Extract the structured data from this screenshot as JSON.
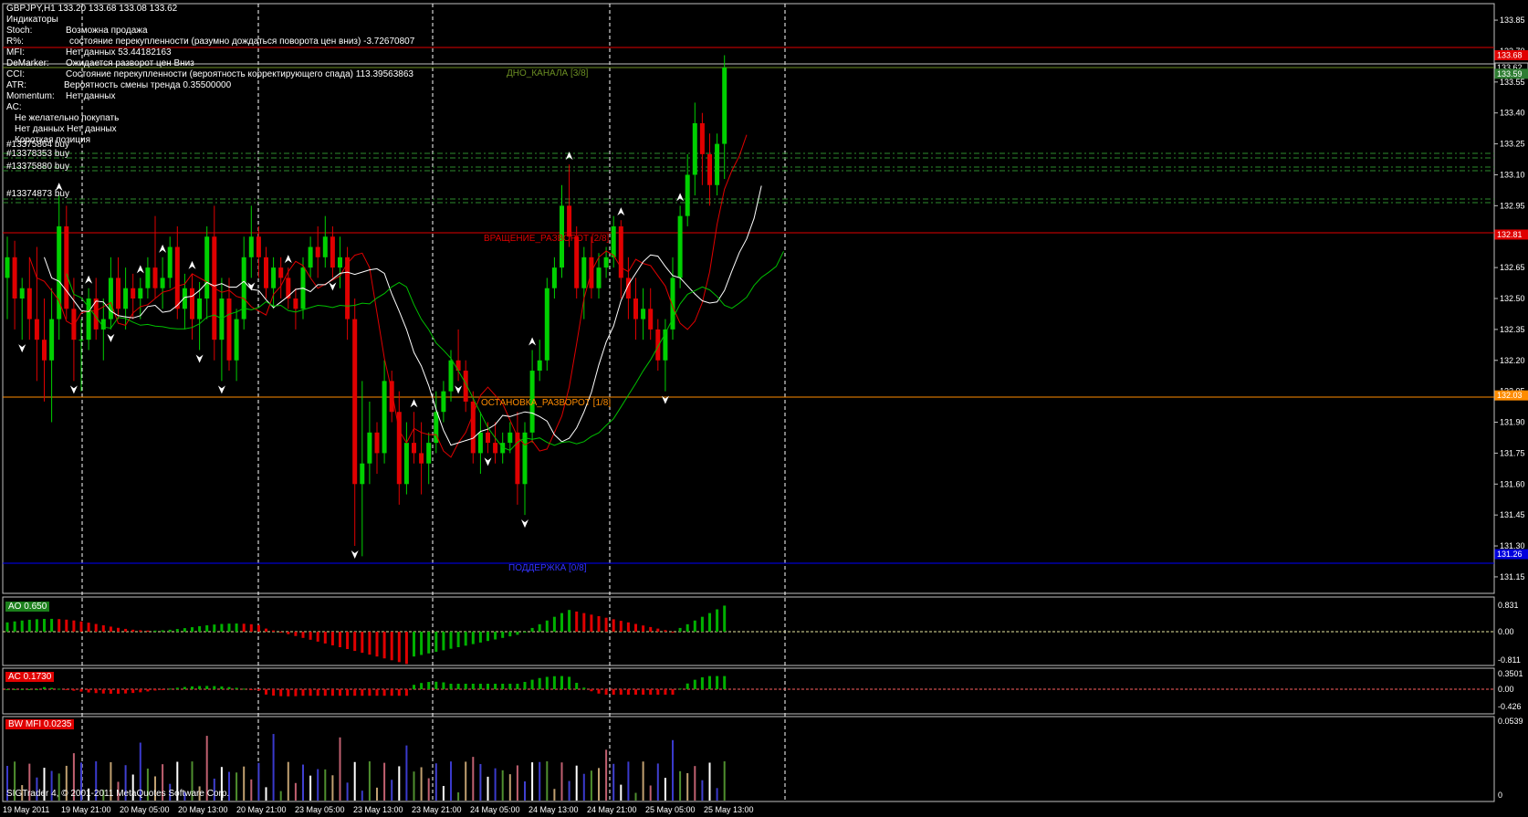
{
  "header": {
    "symbol_line": "GBPJPY,H1  133.20 133.68 133.08 133.62",
    "indicators_title": "Индикаторы",
    "rows": [
      {
        "name": "Stoch:",
        "value": "Возможна продажа"
      },
      {
        "name": "R%:",
        "value": "состояние перекупленности (разумно дождаться поворота цен вниз) -3.72670807"
      },
      {
        "name": "MFI:",
        "value": "Нет данных 53.44182163"
      },
      {
        "name": "DeMarker:",
        "value": "Ожидается разворот цен Вниз"
      },
      {
        "name": "CCI:",
        "value": "Состояние перекупленности (вероятность корректирующего спада) 113.39563863"
      },
      {
        "name": "ATR:",
        "value": "Вероятность смены тренда 0.35500000"
      },
      {
        "name": "Momentum:",
        "value": "Нет данных"
      },
      {
        "name": "AC:",
        "value": ""
      }
    ],
    "notes": [
      "Не желательно покупать",
      "Нет данных Нет данных",
      "Короткая позиция"
    ]
  },
  "orders": [
    "#13375864 buy",
    "#13378353 buy",
    "#13375880 buy",
    "#13374873 buy"
  ],
  "levels": {
    "top_channel": "ДНО_КАНАЛА [3/8]",
    "rotation": "ВРАЩЕНИЕ_РАЗВОРОТ [2/8]",
    "stop": "ОСТАНОВКА_РАЗВОРОТ [1/8]",
    "support": "ПОДДЕРЖКА [0/8]"
  },
  "price_axis": [
    "133.85",
    "133.70",
    "133.55",
    "133.40",
    "133.25",
    "133.10",
    "132.95",
    "132.80",
    "132.65",
    "132.50",
    "132.35",
    "132.20",
    "132.05",
    "131.90",
    "131.75",
    "131.60",
    "131.45",
    "131.30",
    "131.15"
  ],
  "price_tags": [
    {
      "value": "133.68",
      "color": "#e00000"
    },
    {
      "value": "133.62",
      "color": "#000000"
    },
    {
      "value": "133.59",
      "color": "#2e7d32"
    },
    {
      "value": "132.81",
      "color": "#e00000"
    },
    {
      "value": "132.03",
      "color": "#ff8c00"
    },
    {
      "value": "131.26",
      "color": "#0000dd"
    }
  ],
  "time_axis": [
    "19 May 2011",
    "19 May 21:00",
    "20 May 05:00",
    "20 May 13:00",
    "20 May 21:00",
    "23 May 05:00",
    "23 May 13:00",
    "23 May 21:00",
    "24 May 05:00",
    "24 May 13:00",
    "24 May 21:00",
    "25 May 05:00",
    "25 May 13:00"
  ],
  "subwindows": {
    "ao": {
      "label": "AO 0.650",
      "label_color": "#1b7f1b",
      "scale": [
        "0.831",
        "0.00",
        "-0.811"
      ]
    },
    "ac": {
      "label": "AC 0.1730",
      "label_color": "#e00000",
      "scale": [
        "0.3501",
        "0.00",
        "-0.426"
      ]
    },
    "mfi": {
      "label": "BW MFI 0.0235",
      "label_color": "#e00000",
      "scale": [
        "0.0539",
        "0"
      ]
    }
  },
  "copyright": "SIGTrader 4, © 2001-2011 MetaQuotes Software Corp.",
  "colors": {
    "bull": "#00d000",
    "bear": "#e00000",
    "ma_white": "#ffffff",
    "ma_red": "#e00000",
    "ma_green": "#00c000"
  },
  "chart_data": {
    "type": "candlestick",
    "title": "GBPJPY,H1",
    "price_range": [
      131.07,
      133.93
    ],
    "candles": [
      [
        132.6,
        132.8,
        132.4,
        132.7
      ],
      [
        132.7,
        132.78,
        132.35,
        132.5
      ],
      [
        132.5,
        132.6,
        132.3,
        132.55
      ],
      [
        132.55,
        132.7,
        132.3,
        132.4
      ],
      [
        132.4,
        132.75,
        132.1,
        132.3
      ],
      [
        132.3,
        132.5,
        132.0,
        132.2
      ],
      [
        132.2,
        132.55,
        131.9,
        132.4
      ],
      [
        132.4,
        133.0,
        132.3,
        132.85
      ],
      [
        132.85,
        132.95,
        132.4,
        132.45
      ],
      [
        132.45,
        132.6,
        132.1,
        132.3
      ],
      [
        132.3,
        132.4,
        132.05,
        132.3
      ],
      [
        132.3,
        132.55,
        132.25,
        132.5
      ],
      [
        132.5,
        132.6,
        132.3,
        132.35
      ],
      [
        132.35,
        132.5,
        132.2,
        132.4
      ],
      [
        132.4,
        132.7,
        132.35,
        132.6
      ],
      [
        132.6,
        132.7,
        132.4,
        132.45
      ],
      [
        132.45,
        132.65,
        132.35,
        132.55
      ],
      [
        132.55,
        132.62,
        132.4,
        132.5
      ],
      [
        132.5,
        132.6,
        132.4,
        132.55
      ],
      [
        132.55,
        132.7,
        132.5,
        132.65
      ],
      [
        132.65,
        132.9,
        132.5,
        132.55
      ],
      [
        132.55,
        132.7,
        132.45,
        132.6
      ],
      [
        132.6,
        132.8,
        132.55,
        132.75
      ],
      [
        132.75,
        132.85,
        132.4,
        132.45
      ],
      [
        132.45,
        132.62,
        132.35,
        132.55
      ],
      [
        132.55,
        132.62,
        132.3,
        132.4
      ],
      [
        132.4,
        132.58,
        132.25,
        132.5
      ],
      [
        132.5,
        132.85,
        132.4,
        132.8
      ],
      [
        132.8,
        132.95,
        132.2,
        132.3
      ],
      [
        132.3,
        132.6,
        132.1,
        132.5
      ],
      [
        132.5,
        132.6,
        132.15,
        132.2
      ],
      [
        132.2,
        132.45,
        132.1,
        132.4
      ],
      [
        132.4,
        132.8,
        132.35,
        132.7
      ],
      [
        132.7,
        132.95,
        132.6,
        132.8
      ],
      [
        132.8,
        132.85,
        132.6,
        132.7
      ],
      [
        132.7,
        132.75,
        132.5,
        132.55
      ],
      [
        132.55,
        132.7,
        132.45,
        132.65
      ],
      [
        132.65,
        132.7,
        132.5,
        132.6
      ],
      [
        132.6,
        132.65,
        132.45,
        132.5
      ],
      [
        132.5,
        132.55,
        132.35,
        132.45
      ],
      [
        132.45,
        132.7,
        132.4,
        132.65
      ],
      [
        132.65,
        132.8,
        132.6,
        132.75
      ],
      [
        132.75,
        132.85,
        132.6,
        132.7
      ],
      [
        132.7,
        132.9,
        132.65,
        132.8
      ],
      [
        132.8,
        132.85,
        132.6,
        132.65
      ],
      [
        132.65,
        132.8,
        132.55,
        132.7
      ],
      [
        132.7,
        132.75,
        132.3,
        132.4
      ],
      [
        132.4,
        132.5,
        131.3,
        131.6
      ],
      [
        131.6,
        132.1,
        131.25,
        131.7
      ],
      [
        131.7,
        132.0,
        131.6,
        131.85
      ],
      [
        131.85,
        131.9,
        131.65,
        131.75
      ],
      [
        131.75,
        132.2,
        131.7,
        132.1
      ],
      [
        132.1,
        132.15,
        131.9,
        131.95
      ],
      [
        131.95,
        132.05,
        131.5,
        131.6
      ],
      [
        131.6,
        131.9,
        131.55,
        131.8
      ],
      [
        131.8,
        131.95,
        131.7,
        131.75
      ],
      [
        131.75,
        131.9,
        131.55,
        131.7
      ],
      [
        131.7,
        131.85,
        131.6,
        131.8
      ],
      [
        131.8,
        132.05,
        131.75,
        131.95
      ],
      [
        131.95,
        132.1,
        131.9,
        132.05
      ],
      [
        132.05,
        132.25,
        132.0,
        132.2
      ],
      [
        132.2,
        132.35,
        132.1,
        132.15
      ],
      [
        132.15,
        132.2,
        131.95,
        132.0
      ],
      [
        132.0,
        132.05,
        131.7,
        131.75
      ],
      [
        131.75,
        131.95,
        131.65,
        131.85
      ],
      [
        131.85,
        131.9,
        131.75,
        131.8
      ],
      [
        131.8,
        131.9,
        131.7,
        131.75
      ],
      [
        131.75,
        131.85,
        131.7,
        131.8
      ],
      [
        131.8,
        131.9,
        131.75,
        131.85
      ],
      [
        131.85,
        131.95,
        131.5,
        131.6
      ],
      [
        131.6,
        131.9,
        131.45,
        131.85
      ],
      [
        131.85,
        132.25,
        131.8,
        132.15
      ],
      [
        132.15,
        132.3,
        132.1,
        132.2
      ],
      [
        132.2,
        132.6,
        132.15,
        132.55
      ],
      [
        132.55,
        132.7,
        132.5,
        132.65
      ],
      [
        132.65,
        133.05,
        132.6,
        132.95
      ],
      [
        132.95,
        133.15,
        132.75,
        132.8
      ],
      [
        132.8,
        132.85,
        132.5,
        132.55
      ],
      [
        132.55,
        132.75,
        132.4,
        132.7
      ],
      [
        132.7,
        132.8,
        132.5,
        132.55
      ],
      [
        132.55,
        132.72,
        132.5,
        132.65
      ],
      [
        132.65,
        132.75,
        132.6,
        132.7
      ],
      [
        132.7,
        132.9,
        132.65,
        132.85
      ],
      [
        132.85,
        132.88,
        132.5,
        132.6
      ],
      [
        132.6,
        132.7,
        132.4,
        132.5
      ],
      [
        132.5,
        132.6,
        132.3,
        132.4
      ],
      [
        132.4,
        132.55,
        132.3,
        132.45
      ],
      [
        132.45,
        132.55,
        132.3,
        132.35
      ],
      [
        132.35,
        132.4,
        132.15,
        132.2
      ],
      [
        132.2,
        132.4,
        132.05,
        132.35
      ],
      [
        132.35,
        132.7,
        132.3,
        132.6
      ],
      [
        132.6,
        132.95,
        132.55,
        132.9
      ],
      [
        132.9,
        133.2,
        132.85,
        133.1
      ],
      [
        133.1,
        133.45,
        133.0,
        133.35
      ],
      [
        133.35,
        133.4,
        133.05,
        133.2
      ],
      [
        133.2,
        133.3,
        132.95,
        133.05
      ],
      [
        133.05,
        133.3,
        133.0,
        133.25
      ],
      [
        133.25,
        133.68,
        133.08,
        133.62
      ]
    ]
  }
}
